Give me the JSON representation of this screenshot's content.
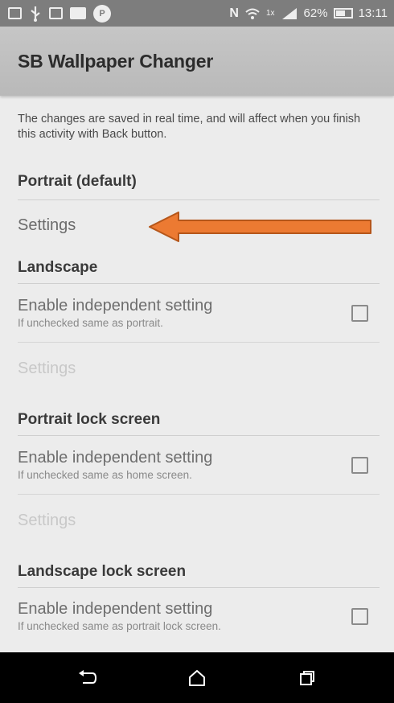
{
  "status_bar": {
    "left_icons": [
      "screen-mirroring-icon",
      "usb-icon",
      "sd-card-icon",
      "notification-box-icon",
      "pin-badge-icon"
    ],
    "pin_badge_label": "P",
    "nfc_label": "N",
    "signal_label": "1x",
    "battery_percent": "62%",
    "time": "13:11"
  },
  "action_bar": {
    "title": "SB Wallpaper Changer"
  },
  "intro_text": "The changes are saved in real time, and will affect when you finish this activity with Back button.",
  "sections": [
    {
      "header": "Portrait (default)",
      "settings_label": "Settings",
      "settings_enabled": true
    },
    {
      "header": "Landscape",
      "toggle_title": "Enable independent setting",
      "toggle_summary": "If unchecked same as portrait.",
      "checked": false,
      "settings_label": "Settings",
      "settings_enabled": false
    },
    {
      "header": "Portrait lock screen",
      "toggle_title": "Enable independent setting",
      "toggle_summary": "If unchecked same as home screen.",
      "checked": false,
      "settings_label": "Settings",
      "settings_enabled": false
    },
    {
      "header": "Landscape lock screen",
      "toggle_title": "Enable independent setting",
      "toggle_summary": "If unchecked same as portrait lock screen.",
      "checked": false
    }
  ],
  "annotation": {
    "arrow_color": "#ec7a32",
    "arrow_outline": "#b5561a"
  },
  "nav_bar": [
    "back-icon",
    "home-icon",
    "recents-icon"
  ]
}
